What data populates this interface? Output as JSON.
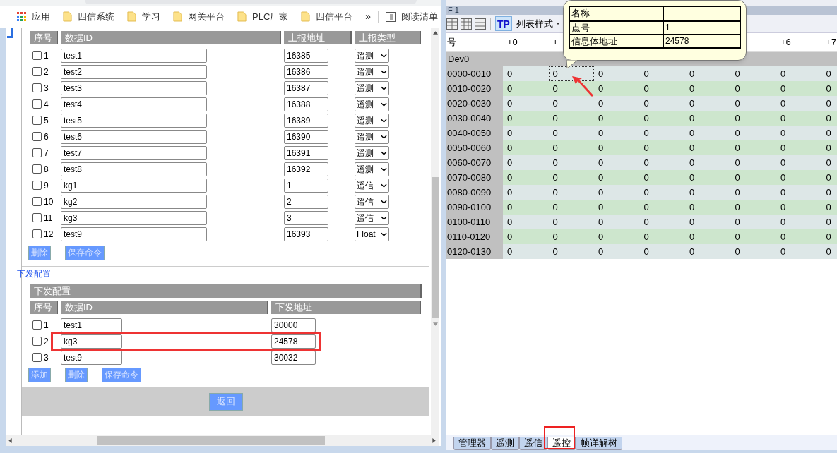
{
  "browser": {
    "bookmarks": [
      {
        "kind": "apps",
        "label": "应用"
      },
      {
        "kind": "folder",
        "label": "四信系统"
      },
      {
        "kind": "folder",
        "label": "学习"
      },
      {
        "kind": "folder",
        "label": "网关平台"
      },
      {
        "kind": "folder",
        "label": "PLC厂家"
      },
      {
        "kind": "folder",
        "label": "四信平台"
      }
    ],
    "overflow": "»",
    "reading_list": "阅读清单"
  },
  "upload_table": {
    "columns": [
      "序号",
      "数据ID",
      "上报地址",
      "上报类型"
    ],
    "rows": [
      {
        "index": "1",
        "checked": false,
        "data_id": "test1",
        "address": "16385",
        "type": "遥测"
      },
      {
        "index": "2",
        "checked": false,
        "data_id": "test2",
        "address": "16386",
        "type": "遥测"
      },
      {
        "index": "3",
        "checked": false,
        "data_id": "test3",
        "address": "16387",
        "type": "遥测"
      },
      {
        "index": "4",
        "checked": false,
        "data_id": "test4",
        "address": "16388",
        "type": "遥测"
      },
      {
        "index": "5",
        "checked": false,
        "data_id": "test5",
        "address": "16389",
        "type": "遥测"
      },
      {
        "index": "6",
        "checked": false,
        "data_id": "test6",
        "address": "16390",
        "type": "遥测"
      },
      {
        "index": "7",
        "checked": false,
        "data_id": "test7",
        "address": "16391",
        "type": "遥测"
      },
      {
        "index": "8",
        "checked": false,
        "data_id": "test8",
        "address": "16392",
        "type": "遥测"
      },
      {
        "index": "9",
        "checked": false,
        "data_id": "kg1",
        "address": "1",
        "type": "遥信"
      },
      {
        "index": "10",
        "checked": false,
        "data_id": "kg2",
        "address": "2",
        "type": "遥信"
      },
      {
        "index": "11",
        "checked": false,
        "data_id": "kg3",
        "address": "3",
        "type": "遥信"
      },
      {
        "index": "12",
        "checked": false,
        "data_id": "test9",
        "address": "16393",
        "type": "Float"
      }
    ],
    "buttons": [
      "删除",
      "保存命令"
    ]
  },
  "downlink": {
    "legend": "下发配置",
    "title": "下发配置",
    "columns": [
      "序号",
      "数据ID",
      "下发地址"
    ],
    "rows": [
      {
        "index": "1",
        "checked": false,
        "data_id": "test1",
        "address": "30000",
        "highlighted": false
      },
      {
        "index": "2",
        "checked": false,
        "data_id": "kg3",
        "address": "24578",
        "highlighted": true
      },
      {
        "index": "3",
        "checked": false,
        "data_id": "test9",
        "address": "30032",
        "highlighted": false
      }
    ],
    "buttons": [
      "添加",
      "删除",
      "保存命令"
    ]
  },
  "return_button": "返回",
  "monitor": {
    "title": "F 1",
    "toolbar": {
      "tp": "TP",
      "tp_active": true,
      "style_menu": "列表样式"
    },
    "header": {
      "corner": "号",
      "columns": [
        "+0",
        "+",
        null,
        null,
        null,
        null,
        "+6",
        "+7"
      ]
    },
    "group": "Dev0",
    "rows": [
      {
        "label": "0000-0010",
        "cells": [
          {
            "value": "0",
            "selected": false
          },
          {
            "value": "0",
            "selected": true
          },
          {
            "value": "0",
            "selected": false
          },
          {
            "value": "0",
            "selected": false
          },
          {
            "value": "0",
            "selected": false
          },
          {
            "value": "0",
            "selected": false
          },
          {
            "value": "0",
            "selected": false
          },
          {
            "value": "0",
            "selected": false
          }
        ]
      },
      {
        "label": "0010-0020",
        "cells": [
          {
            "value": "0",
            "selected": false
          },
          {
            "value": "0",
            "selected": false
          },
          {
            "value": "0",
            "selected": false
          },
          {
            "value": "0",
            "selected": false
          },
          {
            "value": "0",
            "selected": false
          },
          {
            "value": "0",
            "selected": false
          },
          {
            "value": "0",
            "selected": false
          },
          {
            "value": "0",
            "selected": false
          }
        ]
      },
      {
        "label": "0020-0030",
        "cells": [
          {
            "value": "0",
            "selected": false
          },
          {
            "value": "0",
            "selected": false
          },
          {
            "value": "0",
            "selected": false
          },
          {
            "value": "0",
            "selected": false
          },
          {
            "value": "0",
            "selected": false
          },
          {
            "value": "0",
            "selected": false
          },
          {
            "value": "0",
            "selected": false
          },
          {
            "value": "0",
            "selected": false
          }
        ]
      },
      {
        "label": "0030-0040",
        "cells": [
          {
            "value": "0",
            "selected": false
          },
          {
            "value": "0",
            "selected": false
          },
          {
            "value": "0",
            "selected": false
          },
          {
            "value": "0",
            "selected": false
          },
          {
            "value": "0",
            "selected": false
          },
          {
            "value": "0",
            "selected": false
          },
          {
            "value": "0",
            "selected": false
          },
          {
            "value": "0",
            "selected": false
          }
        ]
      },
      {
        "label": "0040-0050",
        "cells": [
          {
            "value": "0",
            "selected": false
          },
          {
            "value": "0",
            "selected": false
          },
          {
            "value": "0",
            "selected": false
          },
          {
            "value": "0",
            "selected": false
          },
          {
            "value": "0",
            "selected": false
          },
          {
            "value": "0",
            "selected": false
          },
          {
            "value": "0",
            "selected": false
          },
          {
            "value": "0",
            "selected": false
          }
        ]
      },
      {
        "label": "0050-0060",
        "cells": [
          {
            "value": "0",
            "selected": false
          },
          {
            "value": "0",
            "selected": false
          },
          {
            "value": "0",
            "selected": false
          },
          {
            "value": "0",
            "selected": false
          },
          {
            "value": "0",
            "selected": false
          },
          {
            "value": "0",
            "selected": false
          },
          {
            "value": "0",
            "selected": false
          },
          {
            "value": "0",
            "selected": false
          }
        ]
      },
      {
        "label": "0060-0070",
        "cells": [
          {
            "value": "0",
            "selected": false
          },
          {
            "value": "0",
            "selected": false
          },
          {
            "value": "0",
            "selected": false
          },
          {
            "value": "0",
            "selected": false
          },
          {
            "value": "0",
            "selected": false
          },
          {
            "value": "0",
            "selected": false
          },
          {
            "value": "0",
            "selected": false
          },
          {
            "value": "0",
            "selected": false
          }
        ]
      },
      {
        "label": "0070-0080",
        "cells": [
          {
            "value": "0",
            "selected": false
          },
          {
            "value": "0",
            "selected": false
          },
          {
            "value": "0",
            "selected": false
          },
          {
            "value": "0",
            "selected": false
          },
          {
            "value": "0",
            "selected": false
          },
          {
            "value": "0",
            "selected": false
          },
          {
            "value": "0",
            "selected": false
          },
          {
            "value": "0",
            "selected": false
          }
        ]
      },
      {
        "label": "0080-0090",
        "cells": [
          {
            "value": "0",
            "selected": false
          },
          {
            "value": "0",
            "selected": false
          },
          {
            "value": "0",
            "selected": false
          },
          {
            "value": "0",
            "selected": false
          },
          {
            "value": "0",
            "selected": false
          },
          {
            "value": "0",
            "selected": false
          },
          {
            "value": "0",
            "selected": false
          },
          {
            "value": "0",
            "selected": false
          }
        ]
      },
      {
        "label": "0090-0100",
        "cells": [
          {
            "value": "0",
            "selected": false
          },
          {
            "value": "0",
            "selected": false
          },
          {
            "value": "0",
            "selected": false
          },
          {
            "value": "0",
            "selected": false
          },
          {
            "value": "0",
            "selected": false
          },
          {
            "value": "0",
            "selected": false
          },
          {
            "value": "0",
            "selected": false
          },
          {
            "value": "0",
            "selected": false
          }
        ]
      },
      {
        "label": "0100-0110",
        "cells": [
          {
            "value": "0",
            "selected": false
          },
          {
            "value": "0",
            "selected": false
          },
          {
            "value": "0",
            "selected": false
          },
          {
            "value": "0",
            "selected": false
          },
          {
            "value": "0",
            "selected": false
          },
          {
            "value": "0",
            "selected": false
          },
          {
            "value": "0",
            "selected": false
          },
          {
            "value": "0",
            "selected": false
          }
        ]
      },
      {
        "label": "0110-0120",
        "cells": [
          {
            "value": "0",
            "selected": false
          },
          {
            "value": "0",
            "selected": false
          },
          {
            "value": "0",
            "selected": false
          },
          {
            "value": "0",
            "selected": false
          },
          {
            "value": "0",
            "selected": false
          },
          {
            "value": "0",
            "selected": false
          },
          {
            "value": "0",
            "selected": false
          },
          {
            "value": "0",
            "selected": false
          }
        ]
      },
      {
        "label": "0120-0130",
        "cells": [
          {
            "value": "0",
            "selected": false
          },
          {
            "value": "0",
            "selected": false
          },
          {
            "value": "0",
            "selected": false
          },
          {
            "value": "0",
            "selected": false
          },
          {
            "value": "0",
            "selected": false
          },
          {
            "value": "0",
            "selected": false
          },
          {
            "value": "0",
            "selected": false
          },
          {
            "value": "0",
            "selected": false
          }
        ]
      }
    ],
    "tooltip": {
      "rows": [
        {
          "label": "名称"
        },
        {
          "label": "点号",
          "value": "1"
        },
        {
          "label": "信息体地址",
          "value": "24578"
        }
      ]
    },
    "tabs": [
      {
        "label": "管理器",
        "selected": false,
        "highlighted": false
      },
      {
        "label": "遥测",
        "selected": false,
        "highlighted": false
      },
      {
        "label": "遥信",
        "selected": false,
        "highlighted": false
      },
      {
        "label": "遥控",
        "selected": true,
        "highlighted": true
      },
      {
        "label": "帧详解树",
        "selected": false,
        "highlighted": false
      }
    ]
  }
}
